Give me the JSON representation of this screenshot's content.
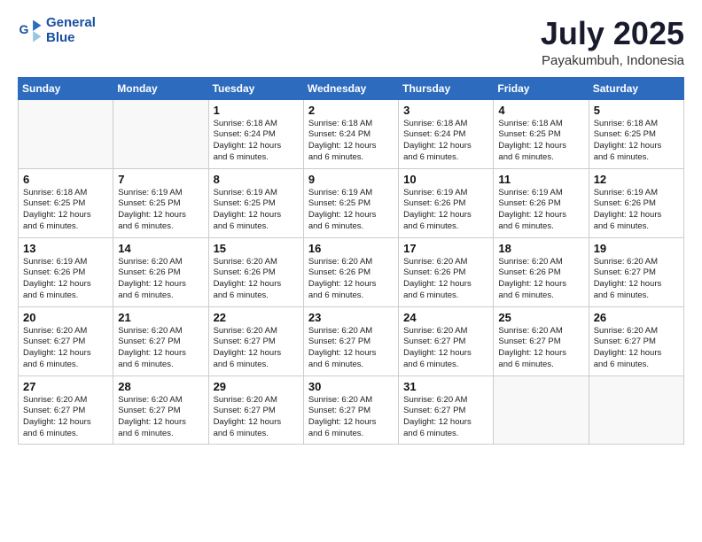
{
  "header": {
    "logo_line1": "General",
    "logo_line2": "Blue",
    "title": "July 2025",
    "subtitle": "Payakumbuh, Indonesia"
  },
  "weekdays": [
    "Sunday",
    "Monday",
    "Tuesday",
    "Wednesday",
    "Thursday",
    "Friday",
    "Saturday"
  ],
  "weeks": [
    [
      {
        "day": "",
        "detail": ""
      },
      {
        "day": "",
        "detail": ""
      },
      {
        "day": "1",
        "detail": "Sunrise: 6:18 AM\nSunset: 6:24 PM\nDaylight: 12 hours\nand 6 minutes."
      },
      {
        "day": "2",
        "detail": "Sunrise: 6:18 AM\nSunset: 6:24 PM\nDaylight: 12 hours\nand 6 minutes."
      },
      {
        "day": "3",
        "detail": "Sunrise: 6:18 AM\nSunset: 6:24 PM\nDaylight: 12 hours\nand 6 minutes."
      },
      {
        "day": "4",
        "detail": "Sunrise: 6:18 AM\nSunset: 6:25 PM\nDaylight: 12 hours\nand 6 minutes."
      },
      {
        "day": "5",
        "detail": "Sunrise: 6:18 AM\nSunset: 6:25 PM\nDaylight: 12 hours\nand 6 minutes."
      }
    ],
    [
      {
        "day": "6",
        "detail": "Sunrise: 6:18 AM\nSunset: 6:25 PM\nDaylight: 12 hours\nand 6 minutes."
      },
      {
        "day": "7",
        "detail": "Sunrise: 6:19 AM\nSunset: 6:25 PM\nDaylight: 12 hours\nand 6 minutes."
      },
      {
        "day": "8",
        "detail": "Sunrise: 6:19 AM\nSunset: 6:25 PM\nDaylight: 12 hours\nand 6 minutes."
      },
      {
        "day": "9",
        "detail": "Sunrise: 6:19 AM\nSunset: 6:25 PM\nDaylight: 12 hours\nand 6 minutes."
      },
      {
        "day": "10",
        "detail": "Sunrise: 6:19 AM\nSunset: 6:26 PM\nDaylight: 12 hours\nand 6 minutes."
      },
      {
        "day": "11",
        "detail": "Sunrise: 6:19 AM\nSunset: 6:26 PM\nDaylight: 12 hours\nand 6 minutes."
      },
      {
        "day": "12",
        "detail": "Sunrise: 6:19 AM\nSunset: 6:26 PM\nDaylight: 12 hours\nand 6 minutes."
      }
    ],
    [
      {
        "day": "13",
        "detail": "Sunrise: 6:19 AM\nSunset: 6:26 PM\nDaylight: 12 hours\nand 6 minutes."
      },
      {
        "day": "14",
        "detail": "Sunrise: 6:20 AM\nSunset: 6:26 PM\nDaylight: 12 hours\nand 6 minutes."
      },
      {
        "day": "15",
        "detail": "Sunrise: 6:20 AM\nSunset: 6:26 PM\nDaylight: 12 hours\nand 6 minutes."
      },
      {
        "day": "16",
        "detail": "Sunrise: 6:20 AM\nSunset: 6:26 PM\nDaylight: 12 hours\nand 6 minutes."
      },
      {
        "day": "17",
        "detail": "Sunrise: 6:20 AM\nSunset: 6:26 PM\nDaylight: 12 hours\nand 6 minutes."
      },
      {
        "day": "18",
        "detail": "Sunrise: 6:20 AM\nSunset: 6:26 PM\nDaylight: 12 hours\nand 6 minutes."
      },
      {
        "day": "19",
        "detail": "Sunrise: 6:20 AM\nSunset: 6:27 PM\nDaylight: 12 hours\nand 6 minutes."
      }
    ],
    [
      {
        "day": "20",
        "detail": "Sunrise: 6:20 AM\nSunset: 6:27 PM\nDaylight: 12 hours\nand 6 minutes."
      },
      {
        "day": "21",
        "detail": "Sunrise: 6:20 AM\nSunset: 6:27 PM\nDaylight: 12 hours\nand 6 minutes."
      },
      {
        "day": "22",
        "detail": "Sunrise: 6:20 AM\nSunset: 6:27 PM\nDaylight: 12 hours\nand 6 minutes."
      },
      {
        "day": "23",
        "detail": "Sunrise: 6:20 AM\nSunset: 6:27 PM\nDaylight: 12 hours\nand 6 minutes."
      },
      {
        "day": "24",
        "detail": "Sunrise: 6:20 AM\nSunset: 6:27 PM\nDaylight: 12 hours\nand 6 minutes."
      },
      {
        "day": "25",
        "detail": "Sunrise: 6:20 AM\nSunset: 6:27 PM\nDaylight: 12 hours\nand 6 minutes."
      },
      {
        "day": "26",
        "detail": "Sunrise: 6:20 AM\nSunset: 6:27 PM\nDaylight: 12 hours\nand 6 minutes."
      }
    ],
    [
      {
        "day": "27",
        "detail": "Sunrise: 6:20 AM\nSunset: 6:27 PM\nDaylight: 12 hours\nand 6 minutes."
      },
      {
        "day": "28",
        "detail": "Sunrise: 6:20 AM\nSunset: 6:27 PM\nDaylight: 12 hours\nand 6 minutes."
      },
      {
        "day": "29",
        "detail": "Sunrise: 6:20 AM\nSunset: 6:27 PM\nDaylight: 12 hours\nand 6 minutes."
      },
      {
        "day": "30",
        "detail": "Sunrise: 6:20 AM\nSunset: 6:27 PM\nDaylight: 12 hours\nand 6 minutes."
      },
      {
        "day": "31",
        "detail": "Sunrise: 6:20 AM\nSunset: 6:27 PM\nDaylight: 12 hours\nand 6 minutes."
      },
      {
        "day": "",
        "detail": ""
      },
      {
        "day": "",
        "detail": ""
      }
    ]
  ]
}
